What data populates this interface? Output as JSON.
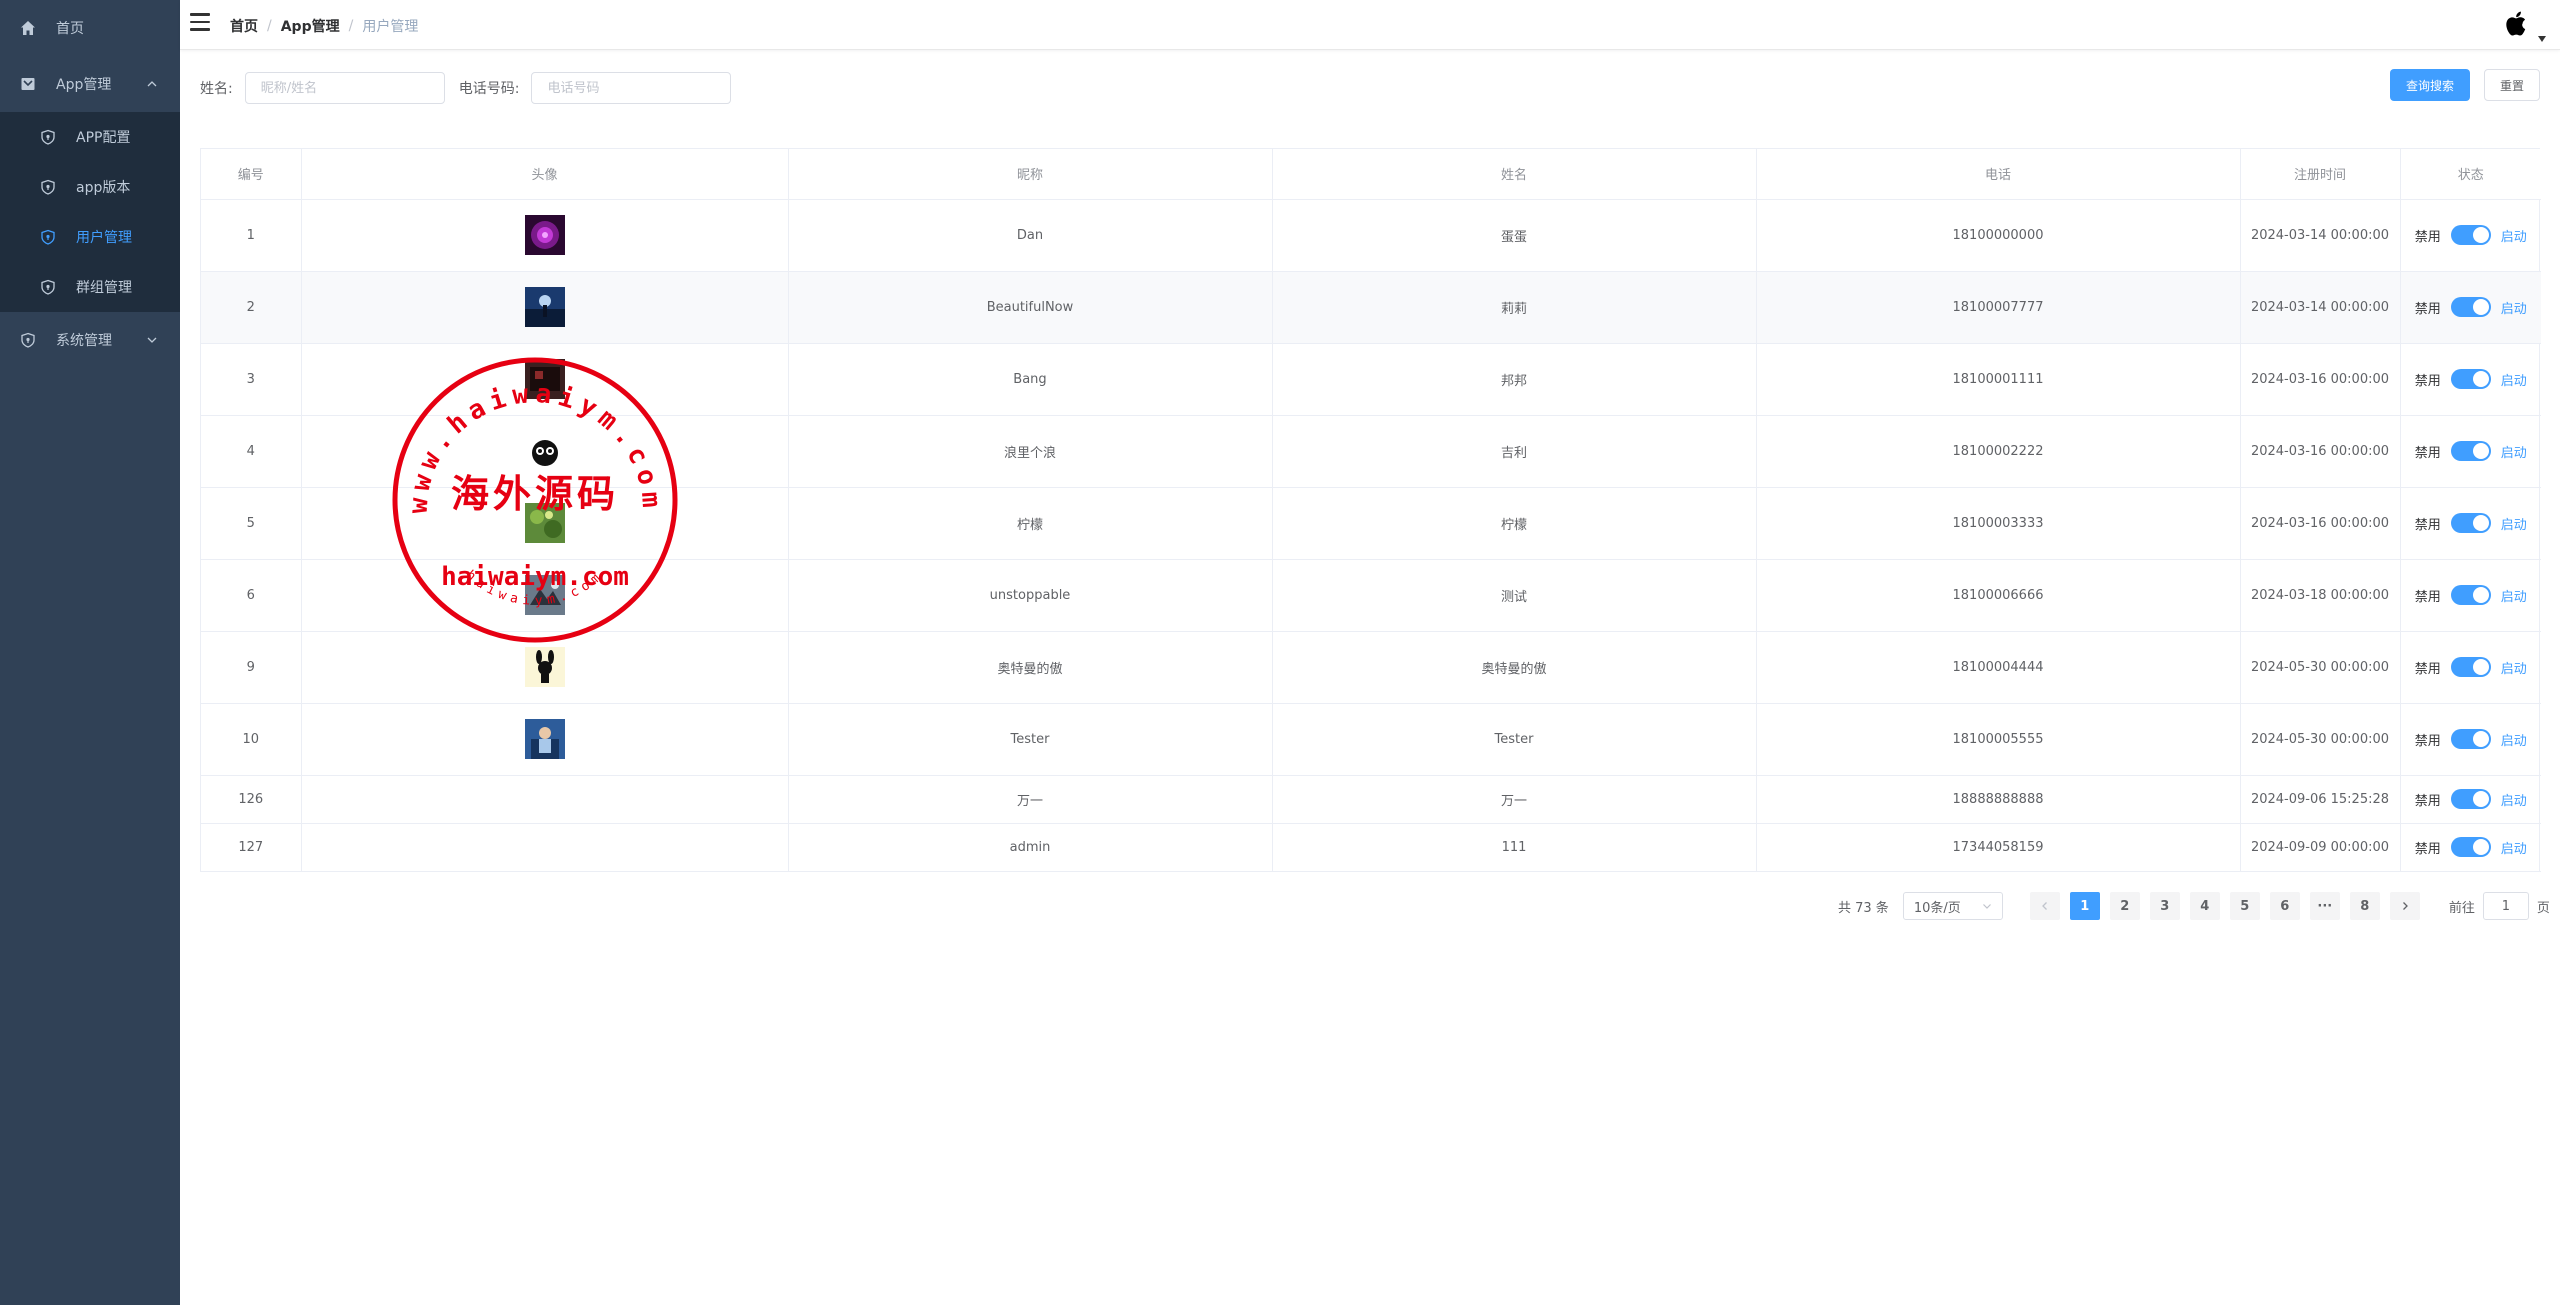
{
  "sidebar": {
    "items": [
      {
        "label": "首页",
        "icon": "home-icon"
      },
      {
        "label": "App管理",
        "icon": "app-icon",
        "expanded": true,
        "children": [
          {
            "label": "APP配置",
            "icon": "shield-icon"
          },
          {
            "label": "app版本",
            "icon": "shield-icon"
          },
          {
            "label": "用户管理",
            "icon": "shield-icon",
            "active": true
          },
          {
            "label": "群组管理",
            "icon": "shield-icon"
          }
        ]
      },
      {
        "label": "系统管理",
        "icon": "shield-icon",
        "expanded": false
      }
    ]
  },
  "header": {
    "breadcrumb": [
      "首页",
      "App管理",
      "用户管理"
    ],
    "avatar_icon": "apple-icon"
  },
  "search": {
    "name_label": "姓名:",
    "name_placeholder": "昵称/姓名",
    "phone_label": "电话号码:",
    "phone_placeholder": "电话号码",
    "query_label": "查询搜索",
    "reset_label": "重置"
  },
  "table": {
    "columns": [
      "编号",
      "头像",
      "昵称",
      "姓名",
      "电话",
      "注册时间",
      "状态"
    ],
    "status_off_label": "禁用",
    "status_on_label": "启动",
    "rows": [
      {
        "id": "1",
        "nickname": "Dan",
        "name": "蛋蛋",
        "phone": "18100000000",
        "registered": "2024-03-14 00:00:00",
        "has_avatar": true
      },
      {
        "id": "2",
        "nickname": "BeautifulNow",
        "name": "莉莉",
        "phone": "18100007777",
        "registered": "2024-03-14 00:00:00",
        "has_avatar": true
      },
      {
        "id": "3",
        "nickname": "Bang",
        "name": "邦邦",
        "phone": "18100001111",
        "registered": "2024-03-16 00:00:00",
        "has_avatar": true
      },
      {
        "id": "4",
        "nickname": "浪里个浪",
        "name": "吉利",
        "phone": "18100002222",
        "registered": "2024-03-16 00:00:00",
        "has_avatar": true
      },
      {
        "id": "5",
        "nickname": "柠檬",
        "name": "柠檬",
        "phone": "18100003333",
        "registered": "2024-03-16 00:00:00",
        "has_avatar": true
      },
      {
        "id": "6",
        "nickname": "unstoppable",
        "name": "测试",
        "phone": "18100006666",
        "registered": "2024-03-18 00:00:00",
        "has_avatar": true
      },
      {
        "id": "9",
        "nickname": "奥特曼的傲",
        "name": "奥特曼的傲",
        "phone": "18100004444",
        "registered": "2024-05-30 00:00:00",
        "has_avatar": true
      },
      {
        "id": "10",
        "nickname": "Tester",
        "name": "Tester",
        "phone": "18100005555",
        "registered": "2024-05-30 00:00:00",
        "has_avatar": true
      },
      {
        "id": "126",
        "nickname": "万一",
        "name": "万一",
        "phone": "18888888888",
        "registered": "2024-09-06 15:25:28",
        "has_avatar": false
      },
      {
        "id": "127",
        "nickname": "admin",
        "name": "111",
        "phone": "17344058159",
        "registered": "2024-09-09 00:00:00",
        "has_avatar": false
      }
    ]
  },
  "pagination": {
    "total_label": "共 73 条",
    "page_size": "10条/页",
    "pages": [
      "1",
      "2",
      "3",
      "4",
      "5",
      "6",
      "···",
      "8"
    ],
    "current": "1",
    "goto_label": "前往",
    "goto_value": "1",
    "page_suffix": "页"
  },
  "watermark": {
    "top_text": "www.haiwaiym.com",
    "center_text": "海外源码",
    "url_text": "haiwaiym.com",
    "bottom_text": "haiwaiym.com"
  },
  "colors": {
    "sidebar_bg": "#304156",
    "submenu_bg": "#1f2d3d",
    "accent": "#409eff",
    "stamp_red": "#e60012"
  }
}
